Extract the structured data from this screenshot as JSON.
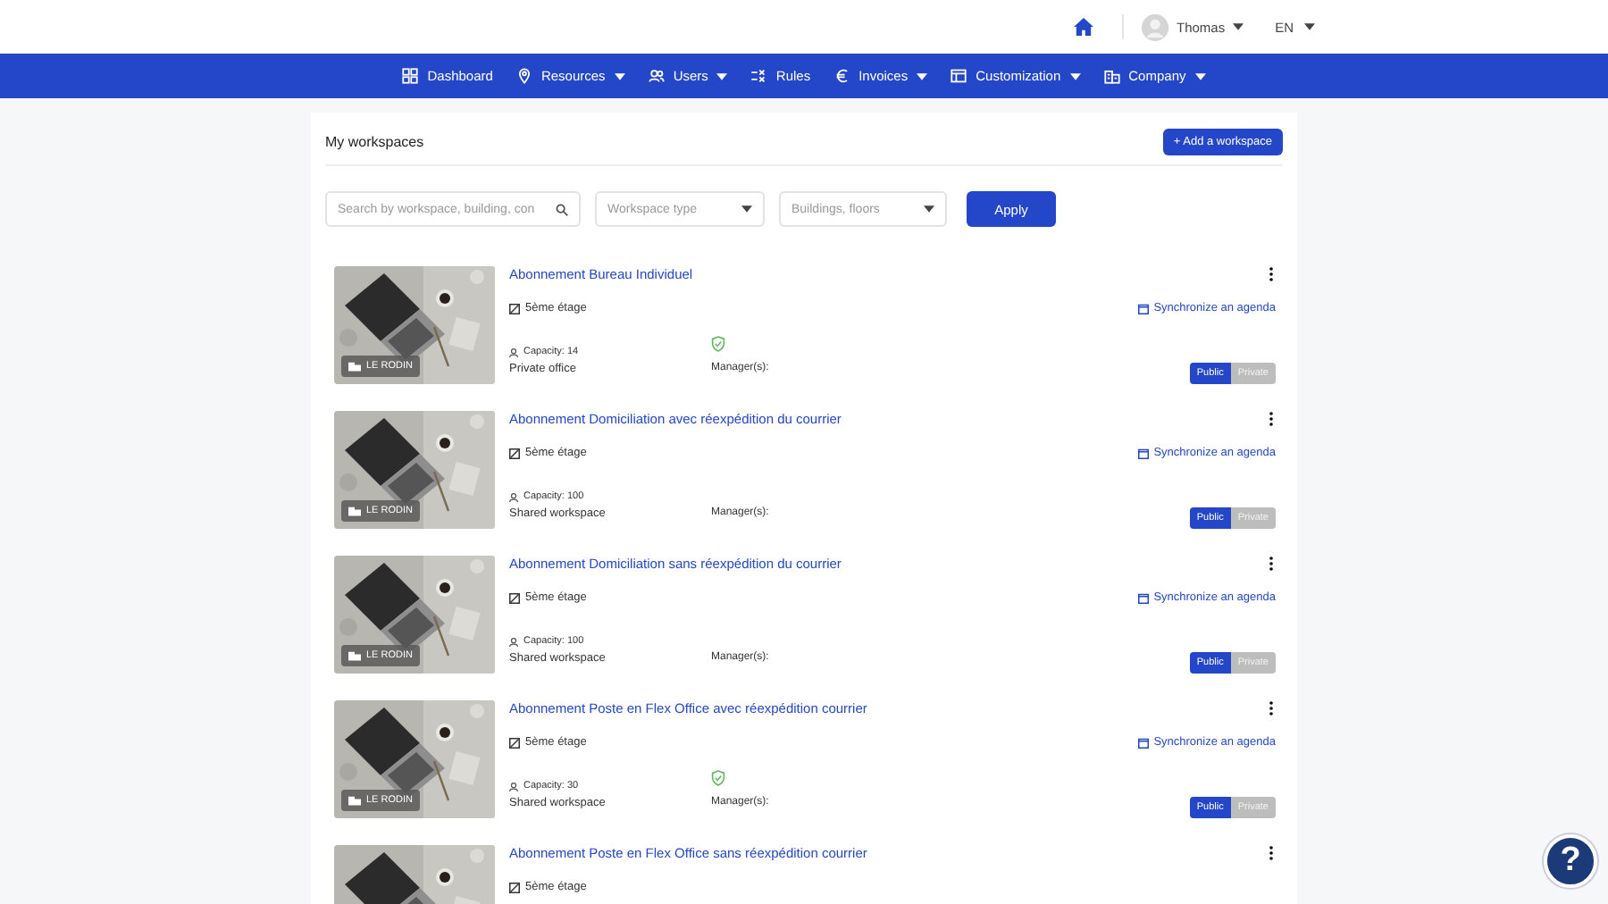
{
  "header": {
    "user": {
      "name": "Thomas"
    },
    "language": "EN"
  },
  "nav": [
    {
      "label": "Dashboard",
      "dropdown": false
    },
    {
      "label": "Resources",
      "dropdown": true
    },
    {
      "label": "Users",
      "dropdown": true
    },
    {
      "label": "Rules",
      "dropdown": false
    },
    {
      "label": "Invoices",
      "dropdown": true
    },
    {
      "label": "Customization",
      "dropdown": true
    },
    {
      "label": "Company",
      "dropdown": true
    }
  ],
  "page": {
    "title": "My workspaces",
    "add_button": "+ Add a workspace"
  },
  "filters": {
    "search": {
      "placeholder": "Search by workspace, building, con"
    },
    "workspace_type": {
      "placeholder": "Workspace type"
    },
    "buildings": {
      "placeholder": "Buildings, floors"
    },
    "apply": "Apply"
  },
  "workspaces": [
    {
      "title": "Abonnement Bureau Individuel",
      "building": "LE RODIN",
      "floor": "5ème étage",
      "sync": "Synchronize an agenda",
      "capacity": "Capacity: 14",
      "verified": true,
      "type": "Private office",
      "manager_label": "Manager(s):",
      "visibility": [
        {
          "label": "Public",
          "selected": true
        },
        {
          "label": "Private",
          "selected": false
        }
      ]
    },
    {
      "title": "Abonnement Domiciliation avec réexpédition du courrier",
      "building": "LE RODIN",
      "floor": "5ème étage",
      "sync": "Synchronize an agenda",
      "capacity": "Capacity: 100",
      "verified": false,
      "type": "Shared workspace",
      "manager_label": "Manager(s):",
      "visibility": [
        {
          "label": "Public",
          "selected": true
        },
        {
          "label": "Private",
          "selected": false
        }
      ]
    },
    {
      "title": "Abonnement Domiciliation sans réexpédition du courrier",
      "building": "LE RODIN",
      "floor": "5ème étage",
      "sync": "Synchronize an agenda",
      "capacity": "Capacity: 100",
      "verified": false,
      "type": "Shared workspace",
      "manager_label": "Manager(s):",
      "visibility": [
        {
          "label": "Public",
          "selected": true
        },
        {
          "label": "Private",
          "selected": false
        }
      ]
    },
    {
      "title": "Abonnement Poste en Flex Office avec réexpédition courrier",
      "building": "LE RODIN",
      "floor": "5ème étage",
      "sync": "Synchronize an agenda",
      "capacity": "Capacity: 30",
      "verified": true,
      "type": "Shared workspace",
      "manager_label": "Manager(s):",
      "visibility": [
        {
          "label": "Public",
          "selected": true
        },
        {
          "label": "Private",
          "selected": false
        }
      ]
    },
    {
      "title": "Abonnement Poste en Flex Office sans réexpédition courrier",
      "floor": "5ème étage"
    }
  ],
  "help": {
    "label": "?"
  }
}
